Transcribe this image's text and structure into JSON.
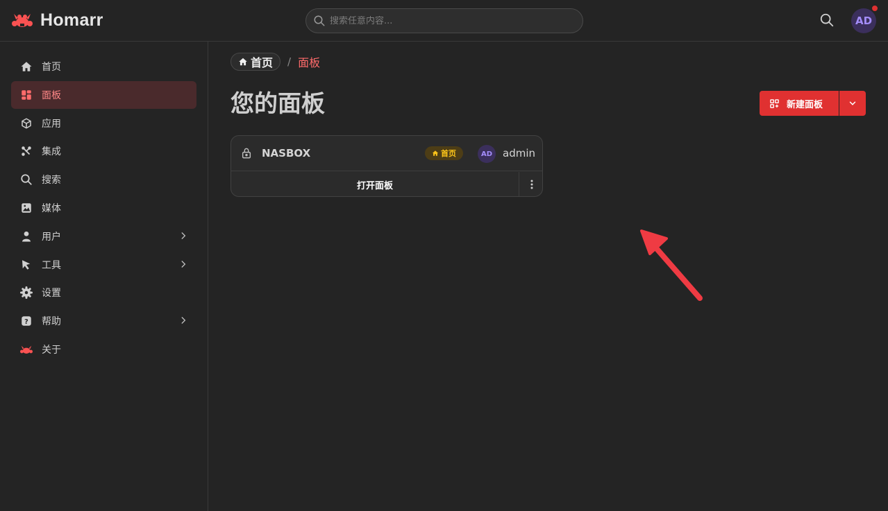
{
  "app": {
    "name": "Homarr"
  },
  "search": {
    "placeholder": "搜索任意内容..."
  },
  "user": {
    "initials": "AD"
  },
  "sidebar": {
    "items": [
      {
        "label": "首页",
        "icon": "home-icon"
      },
      {
        "label": "面板",
        "icon": "layout-dashboard-icon",
        "active": true
      },
      {
        "label": "应用",
        "icon": "box-icon"
      },
      {
        "label": "集成",
        "icon": "plug-connected-icon"
      },
      {
        "label": "搜索",
        "icon": "search-icon"
      },
      {
        "label": "媒体",
        "icon": "photo-icon"
      },
      {
        "label": "用户",
        "icon": "user-icon",
        "expandable": true
      },
      {
        "label": "工具",
        "icon": "pointer-icon",
        "expandable": true
      },
      {
        "label": "设置",
        "icon": "settings-icon"
      },
      {
        "label": "帮助",
        "icon": "question-mark-icon",
        "expandable": true
      },
      {
        "label": "关于",
        "icon": "homarr-logo-icon"
      }
    ]
  },
  "breadcrumb": {
    "home": "首页",
    "current": "面板"
  },
  "page": {
    "title": "您的面板"
  },
  "actions": {
    "new_board": "新建面板"
  },
  "boards": [
    {
      "name": "NASBOX",
      "badge": "首页",
      "owner_initials": "AD",
      "owner": "admin",
      "open_label": "打开面板"
    }
  ],
  "colors": {
    "accent": "#e03131",
    "active_text": "#ff6b6b",
    "badge": "#fcc419",
    "avatar": "#a48dfa"
  }
}
